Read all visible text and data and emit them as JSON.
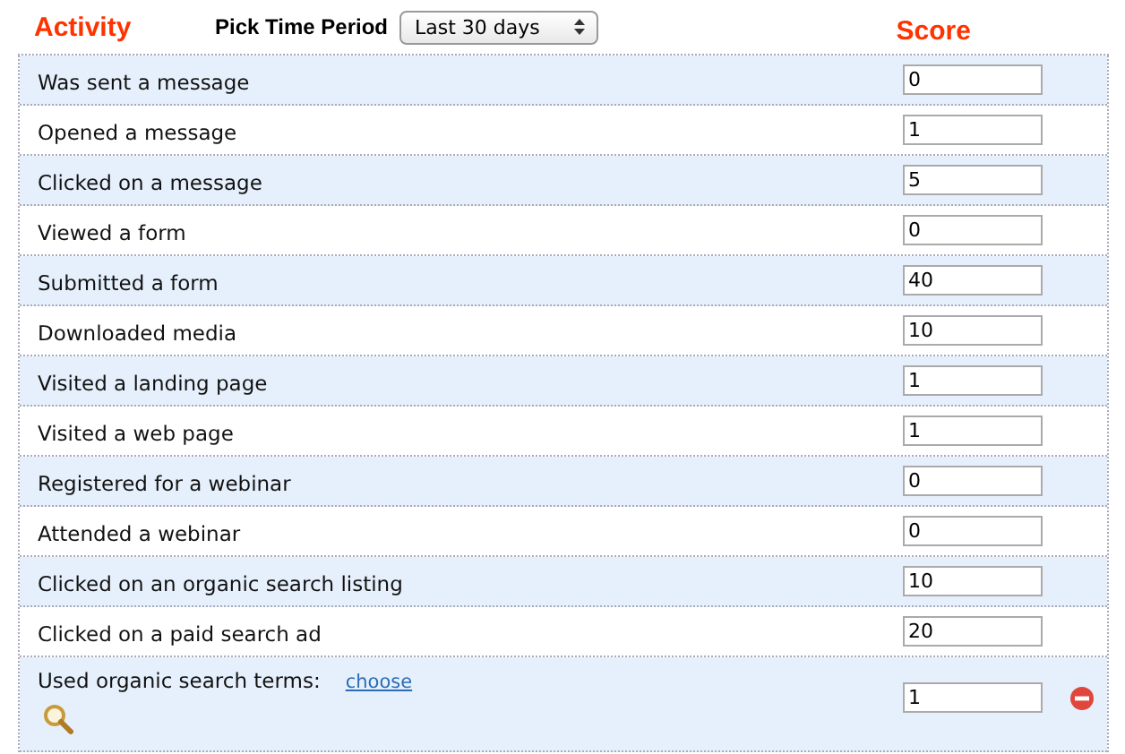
{
  "header": {
    "activity_label": "Activity",
    "period_label": "Pick Time Period",
    "period_value": "Last 30 days",
    "score_label": "Score"
  },
  "rows": [
    {
      "kind": "plain",
      "activity": "Was sent a message",
      "score": "0"
    },
    {
      "kind": "plain",
      "activity": "Opened a message",
      "score": "1"
    },
    {
      "kind": "plain",
      "activity": "Clicked on a message",
      "score": "5"
    },
    {
      "kind": "plain",
      "activity": "Viewed a form",
      "score": "0"
    },
    {
      "kind": "plain",
      "activity": "Submitted a form",
      "score": "40"
    },
    {
      "kind": "plain",
      "activity": "Downloaded media",
      "score": "10"
    },
    {
      "kind": "plain",
      "activity": "Visited a landing page",
      "score": "1"
    },
    {
      "kind": "plain",
      "activity": "Visited a web page",
      "score": "1"
    },
    {
      "kind": "plain",
      "activity": "Registered for a webinar",
      "score": "0"
    },
    {
      "kind": "plain",
      "activity": "Attended a webinar",
      "score": "0"
    },
    {
      "kind": "plain",
      "activity": "Clicked on an organic search listing",
      "score": "10"
    },
    {
      "kind": "plain",
      "activity": "Clicked on a paid search ad",
      "score": "20"
    },
    {
      "kind": "terms",
      "activity": "Used organic search terms:",
      "link": "choose",
      "score": "1"
    }
  ]
}
